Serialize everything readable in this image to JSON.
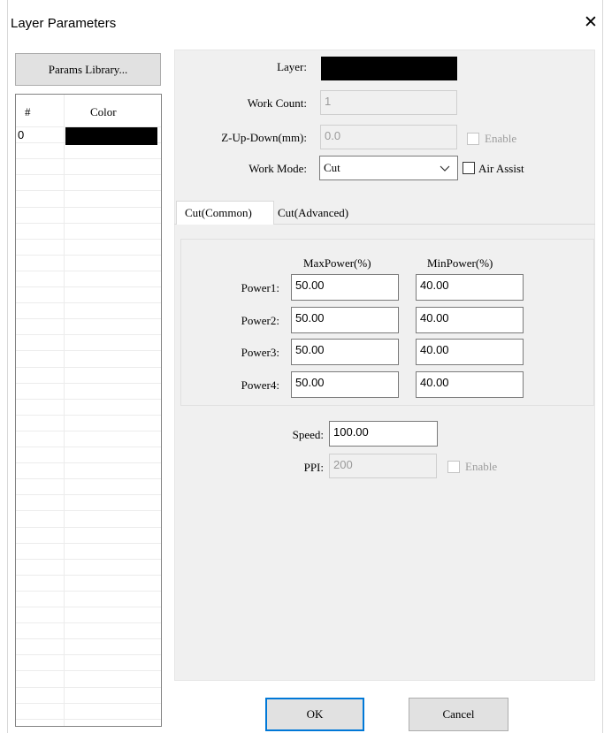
{
  "dialog": {
    "title": "Layer Parameters",
    "close_glyph": "✕"
  },
  "left": {
    "params_library_label": "Params Library...",
    "columns": [
      "#",
      "Color"
    ],
    "layers": [
      {
        "index": "0",
        "color": "#000000"
      }
    ]
  },
  "layer": {
    "label": "Layer:",
    "color": "#000000"
  },
  "work_count": {
    "label": "Work Count:",
    "value": "1"
  },
  "z_up_down": {
    "label": "Z-Up-Down(mm):",
    "value": "0.0",
    "enable_label": "Enable",
    "enabled": false
  },
  "work_mode": {
    "label": "Work Mode:",
    "selected": "Cut",
    "dropdown_icon": "chevron-down-icon"
  },
  "air_assist": {
    "label": "Air Assist",
    "checked": false
  },
  "tabs": [
    {
      "label": "Cut(Common)",
      "active": true
    },
    {
      "label": "Cut(Advanced)",
      "active": false
    }
  ],
  "power": {
    "max_header": "MaxPower(%)",
    "min_header": "MinPower(%)",
    "rows": [
      {
        "label": "Power1:",
        "max": "50.00",
        "min": "40.00"
      },
      {
        "label": "Power2:",
        "max": "50.00",
        "min": "40.00"
      },
      {
        "label": "Power3:",
        "max": "50.00",
        "min": "40.00"
      },
      {
        "label": "Power4:",
        "max": "50.00",
        "min": "40.00"
      }
    ]
  },
  "speed": {
    "label": "Speed:",
    "value": "100.00"
  },
  "ppi": {
    "label": "PPI:",
    "value": "200",
    "enable_label": "Enable",
    "enabled": false
  },
  "buttons": {
    "ok": "OK",
    "cancel": "Cancel"
  }
}
